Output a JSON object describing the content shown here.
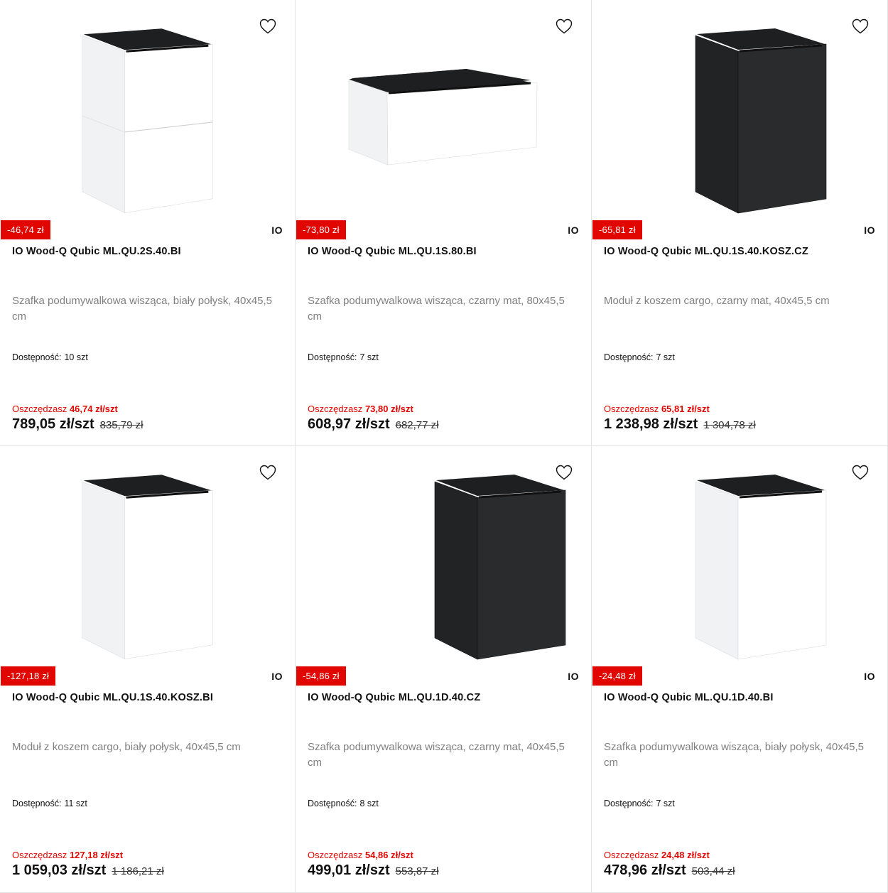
{
  "colors": {
    "accent": "#e10600",
    "text": "#111111",
    "muted": "#808080"
  },
  "products": [
    {
      "discount": "-46,74 zł",
      "brand": "IO",
      "name": "IO Wood-Q Qubic ML.QU.2S.40.BI",
      "description": "Szafka podumywalkowa wisząca, biały połysk, 40x45,5 cm",
      "availability_label": "Dostępność:",
      "availability_value": "10 szt",
      "save_label": "Oszczędzasz",
      "save_amount": "46,74 zł/szt",
      "price": "789,05 zł/szt",
      "old_price": "835,79 zł",
      "image": {
        "icon": "cabinet-two-drawers-white",
        "color": "white",
        "shape": "tall-2drawer"
      }
    },
    {
      "discount": "-73,80 zł",
      "brand": "IO",
      "name": "IO Wood-Q Qubic ML.QU.1S.80.BI",
      "description": "Szafka podumywalkowa wisząca, czarny mat, 80x45,5 cm",
      "availability_label": "Dostępność:",
      "availability_value": "7 szt",
      "save_label": "Oszczędzasz",
      "save_amount": "73,80 zł/szt",
      "price": "608,97 zł/szt",
      "old_price": "682,77 zł",
      "image": {
        "icon": "cabinet-wide-drawer-white",
        "color": "white",
        "shape": "wide"
      }
    },
    {
      "discount": "-65,81 zł",
      "brand": "IO",
      "name": "IO Wood-Q Qubic ML.QU.1S.40.KOSZ.CZ",
      "description": "Moduł z koszem cargo, czarny mat, 40x45,5 cm",
      "availability_label": "Dostępność:",
      "availability_value": "7 szt",
      "save_label": "Oszczędzasz",
      "save_amount": "65,81 zł/szt",
      "price": "1 238,98 zł/szt",
      "old_price": "1 304,78 zł",
      "image": {
        "icon": "cabinet-tall-black",
        "color": "black",
        "shape": "tall"
      }
    },
    {
      "discount": "-127,18 zł",
      "brand": "IO",
      "name": "IO Wood-Q Qubic ML.QU.1S.40.KOSZ.BI",
      "description": "Moduł z koszem cargo, biały połysk, 40x45,5 cm",
      "availability_label": "Dostępność:",
      "availability_value": "11 szt",
      "save_label": "Oszczędzasz",
      "save_amount": "127,18 zł/szt",
      "price": "1 059,03 zł/szt",
      "old_price": "1 186,21 zł",
      "image": {
        "icon": "cabinet-tall-white",
        "color": "white",
        "shape": "tall-1drawer"
      }
    },
    {
      "discount": "-54,86 zł",
      "brand": "IO",
      "name": "IO Wood-Q Qubic ML.QU.1D.40.CZ",
      "description": "Szafka podumywalkowa wisząca, czarny mat, 40x45,5 cm",
      "availability_label": "Dostępność:",
      "availability_value": "8 szt",
      "save_label": "Oszczędzasz",
      "save_amount": "54,86 zł/szt",
      "price": "499,01 zł/szt",
      "old_price": "553,87 zł",
      "image": {
        "icon": "cabinet-door-black",
        "color": "black",
        "shape": "door"
      }
    },
    {
      "discount": "-24,48 zł",
      "brand": "IO",
      "name": "IO Wood-Q Qubic ML.QU.1D.40.BI",
      "description": "Szafka podumywalkowa wisząca, biały połysk, 40x45,5 cm",
      "availability_label": "Dostępność:",
      "availability_value": "7 szt",
      "save_label": "Oszczędzasz",
      "save_amount": "24,48 zł/szt",
      "price": "478,96 zł/szt",
      "old_price": "503,44 zł",
      "image": {
        "icon": "cabinet-door-white",
        "color": "white",
        "shape": "door"
      }
    }
  ]
}
